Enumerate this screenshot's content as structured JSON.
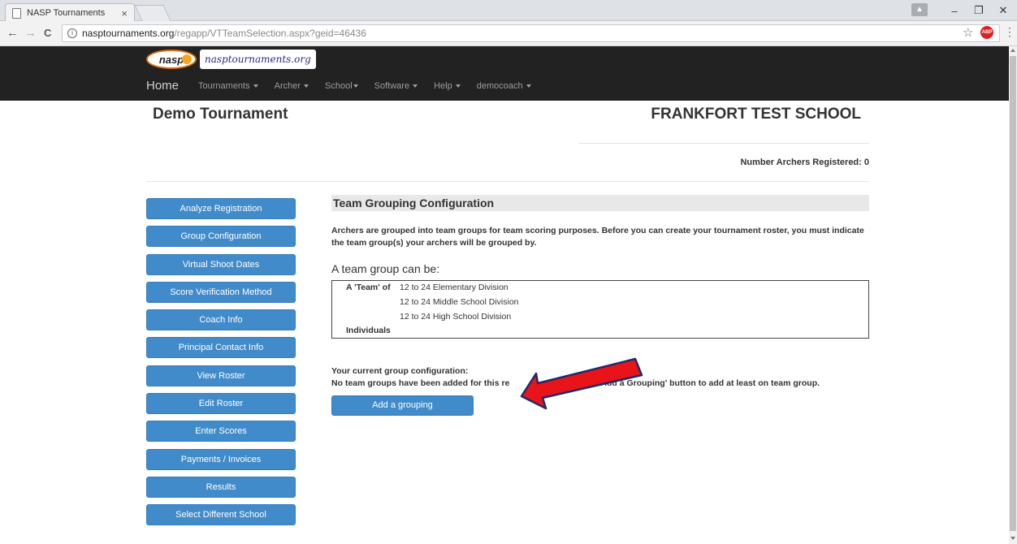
{
  "browser": {
    "tab_title": "NASP Tournaments",
    "tab_close": "×",
    "url_host": "nasptournaments.org",
    "url_path": "/regapp/VTTeamSelection.aspx?geid=46436",
    "minimize": "–",
    "restore": "❐",
    "close": "✕",
    "back": "←",
    "forward": "→",
    "reload": "C",
    "star": "☆",
    "menu": "⋮",
    "adblock": "ABP"
  },
  "site": {
    "logo_text": "nasp",
    "wordmark": "nasptournaments.org",
    "nav": {
      "home": "Home",
      "tournaments": "Tournaments",
      "archer": "Archer",
      "school": "School",
      "software": "Software",
      "help": "Help",
      "user": "democoach"
    }
  },
  "page": {
    "tournament_title": "Demo Tournament",
    "school_name": "FRANKFORT TEST SCHOOL",
    "archers_registered": "Number Archers Registered: 0"
  },
  "sidebar": {
    "items": [
      "Analyze Registration",
      "Group Configuration",
      "Virtual Shoot Dates",
      "Score Verification Method",
      "Coach Info",
      "Principal Contact Info",
      "View Roster",
      "Edit Roster",
      "Enter Scores",
      "Payments / Invoices",
      "Results",
      "Select Different School"
    ]
  },
  "main": {
    "section_title": "Team Grouping Configuration",
    "intro": "Archers are grouped into team groups for team scoring purposes. Before you can create your tournament roster, you must indicate the team group(s) your archers will be grouped by.",
    "can_be": "A team group can be:",
    "team_of": "A 'Team' of",
    "divisions": [
      "12 to 24 Elementary Division",
      "12 to 24 Middle School Division",
      "12 to 24 High School Division"
    ],
    "individuals": "Individuals",
    "current_title": "Your current group configuration:",
    "current_status_a": "No team groups have been added for this re",
    "current_status_b": "Add a Grouping' button to add at least on team group.",
    "add_button": "Add a grouping"
  },
  "colors": {
    "button_blue": "#428bca",
    "header_bg": "#222222",
    "arrow_red": "#e8141a",
    "arrow_outline": "#1d2b6b"
  }
}
